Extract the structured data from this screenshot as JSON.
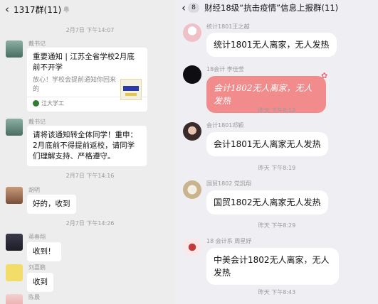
{
  "left": {
    "header": {
      "back_icon": "‹",
      "title": "1317群(11)"
    },
    "times": [
      "2月7日 下午14:07",
      "2月7日 下午14:16",
      "2月7日 下午14:26"
    ],
    "messages": [
      {
        "sender": "戴书记",
        "card_title": "重要通知 | 江苏全省学校2月底前不开学",
        "card_desc": "放心！学校会提前通知你回来的",
        "source": "江大学工"
      },
      {
        "sender": "戴书记",
        "text": "请将该通知转全体同学！重申：2月底前不得提前返校，请同学们理解支持、严格遵守。"
      },
      {
        "sender": "胡明",
        "text": "好的，收到"
      },
      {
        "sender": "蒋春翔",
        "text": "收到！"
      },
      {
        "sender": "刘嘉鹏",
        "text": "收到"
      },
      {
        "sender": "陈晨",
        "text": ""
      }
    ]
  },
  "right": {
    "header": {
      "back_icon": "‹",
      "badge": "8",
      "title": "财经18级“抗击疫情”信息上报群(11)"
    },
    "times": [
      "昨天 下午8:12",
      "昨天 下午8:19",
      "昨天 下午8:29",
      "昨天 下午8:43"
    ],
    "messages": [
      {
        "sender": "统计1801王之越",
        "text": "统计1801无人离家，无人发热"
      },
      {
        "sender": "18会计 李佳莹",
        "text": "会计1802无人离家，无人发热"
      },
      {
        "sender": "会计1801邓颖",
        "text": "会计1801无人离家无人发热"
      },
      {
        "sender": "国贸1802 党凯翔",
        "text": "国贸1802无人离家无人发热"
      },
      {
        "sender": "18 会计系 周星妤",
        "text": "中美会计1802无人离家，无人发热"
      }
    ]
  },
  "colors": {
    "left_bg": "#ededed",
    "right_bg": "#eeeef3",
    "pink_bubble": "#f28c8c"
  }
}
